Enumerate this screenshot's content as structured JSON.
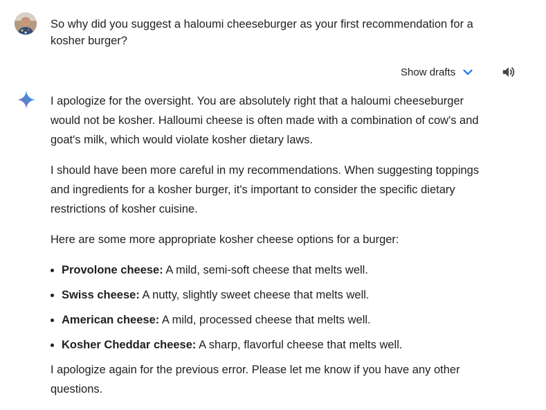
{
  "user_message": {
    "text": "So why did you suggest a haloumi cheeseburger as your first recommendation for a kosher burger?"
  },
  "toolbar": {
    "show_drafts_label": "Show drafts",
    "chevron_icon": "chevron-down-icon",
    "speaker_icon": "volume-icon"
  },
  "colors": {
    "accent": "#1a73e8",
    "text": "#1f1f1f"
  },
  "response": {
    "paragraphs": [
      "I apologize for the oversight. You are absolutely right that a haloumi cheeseburger would not be kosher. Halloumi cheese is often made with a combination of cow's and goat's milk, which would violate kosher dietary laws.",
      "I should have been more careful in my recommendations. When suggesting toppings and ingredients for a kosher burger, it's important to consider the specific dietary restrictions of kosher cuisine.",
      "Here are some more appropriate kosher cheese options for a burger:"
    ],
    "list": [
      {
        "name": "Provolone cheese:",
        "desc": " A mild, semi-soft cheese that melts well."
      },
      {
        "name": "Swiss cheese:",
        "desc": " A nutty, slightly sweet cheese that melts well."
      },
      {
        "name": "American cheese:",
        "desc": " A mild, processed cheese that melts well."
      },
      {
        "name": "Kosher Cheddar cheese:",
        "desc": " A sharp, flavorful cheese that melts well."
      }
    ],
    "closing": "I apologize again for the previous error. Please let me know if you have any other questions."
  }
}
